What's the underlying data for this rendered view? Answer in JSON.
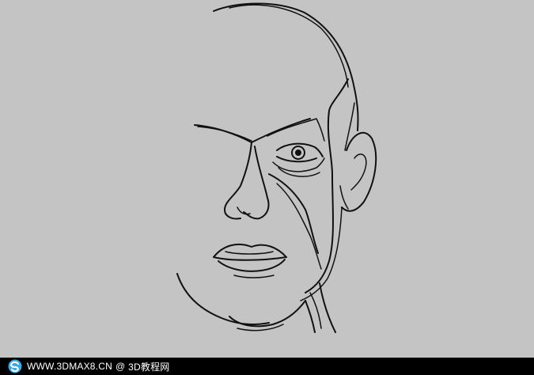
{
  "canvas": {
    "background": "#c4c4c4",
    "stroke": "#111111"
  },
  "watermark": {
    "logo_icon": "swirl-logo-icon",
    "site": "WWW.3DMAX8.CN",
    "separator": "@",
    "site_name": "3D教程网",
    "bar_color": "#000000",
    "text_color": "#ffffff",
    "logo_color": "#3da8e6"
  }
}
